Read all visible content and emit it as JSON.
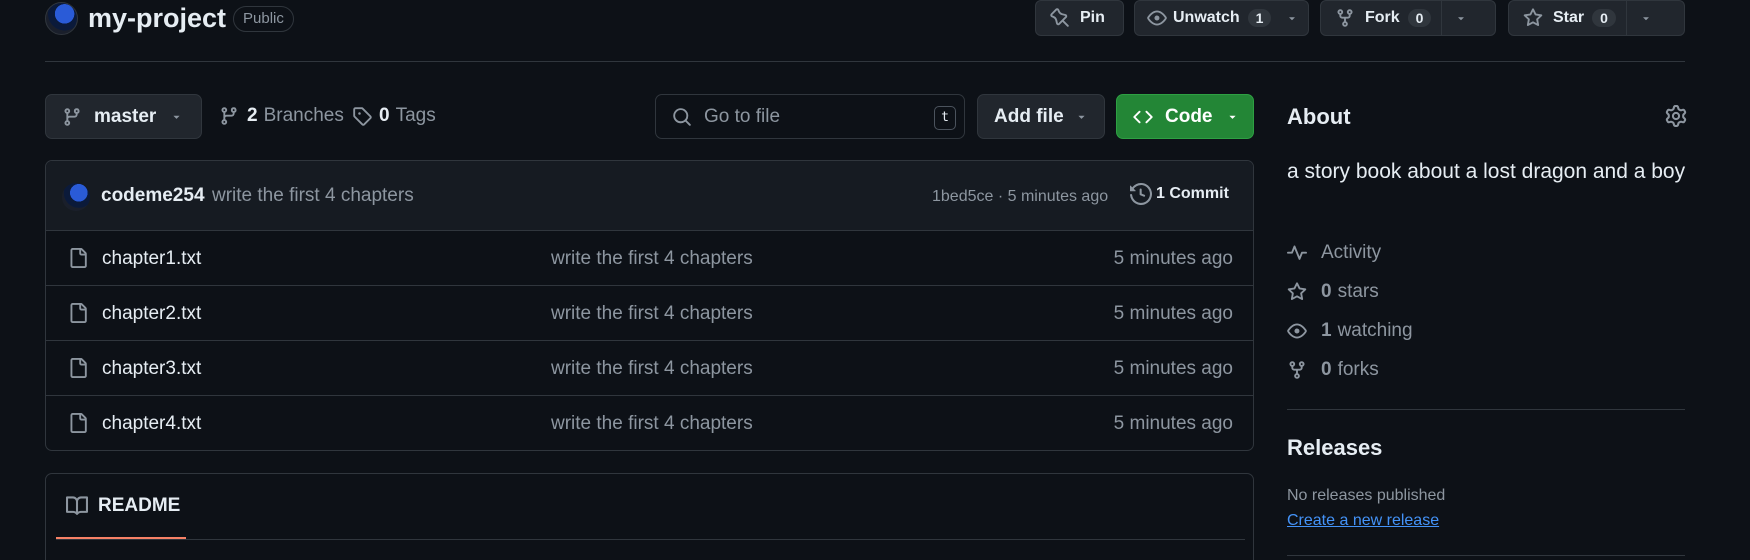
{
  "repo": {
    "name": "my-project",
    "visibility": "Public"
  },
  "actions": {
    "pin": "Pin",
    "watch": {
      "label": "Unwatch",
      "count": "1"
    },
    "fork": {
      "label": "Fork",
      "count": "0"
    },
    "star": {
      "label": "Star",
      "count": "0"
    }
  },
  "toolbar": {
    "branch": "master",
    "branches_count": "2",
    "branches_label": "Branches",
    "tags_count": "0",
    "tags_label": "Tags",
    "search_placeholder": "Go to file",
    "search_shortcut": "t",
    "add_file": "Add file",
    "code": "Code"
  },
  "commit": {
    "user": "codeme254",
    "message": "write the first 4 chapters",
    "meta": "1bed5ce · 5 minutes ago",
    "history": "1 Commit"
  },
  "files": [
    {
      "name": "chapter1.txt",
      "message": "write the first 4 chapters",
      "date": "5 minutes ago"
    },
    {
      "name": "chapter2.txt",
      "message": "write the first 4 chapters",
      "date": "5 minutes ago"
    },
    {
      "name": "chapter3.txt",
      "message": "write the first 4 chapters",
      "date": "5 minutes ago"
    },
    {
      "name": "chapter4.txt",
      "message": "write the first 4 chapters",
      "date": "5 minutes ago"
    }
  ],
  "readme": {
    "tab": "README"
  },
  "about": {
    "title": "About",
    "description": "a story book about a lost dragon and a boy",
    "activity": "Activity",
    "stars_count": "0",
    "stars_label": "stars",
    "watching_count": "1",
    "watching_label": "watching",
    "forks_count": "0",
    "forks_label": "forks"
  },
  "releases": {
    "title": "Releases",
    "none": "No releases published",
    "create_link": "Create a new release"
  },
  "colors": {
    "accent_green": "#238636",
    "link": "#4493f8",
    "tab_underline": "#f78166",
    "bg": "#0d1117"
  }
}
